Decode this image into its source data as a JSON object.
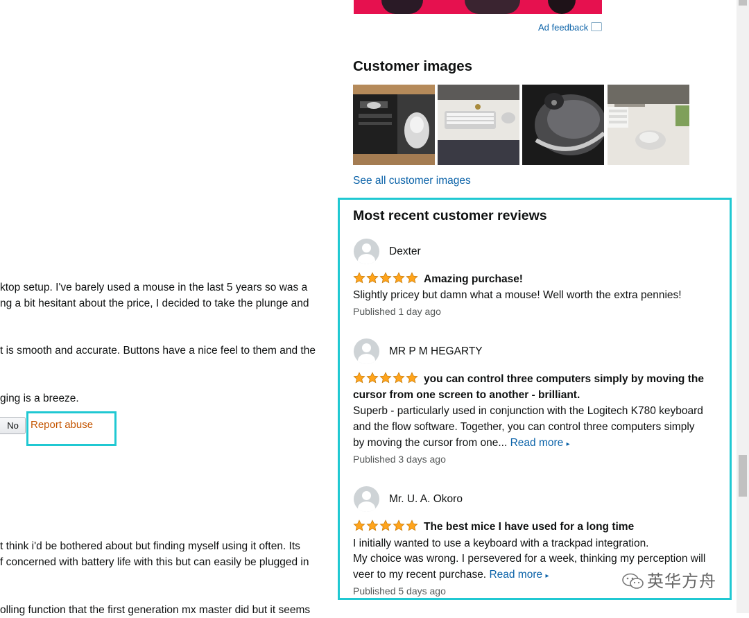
{
  "left_review": {
    "lines": [
      "ktop setup. I've barely used a mouse in the last 5 years so was a",
      "ng a bit hesitant about the price, I decided to take the plunge and",
      "t is smooth and accurate. Buttons have a nice feel to them and the",
      "ging is a breeze."
    ],
    "no_button": "No",
    "report_abuse": "Report abuse"
  },
  "left_review_2": {
    "lines": [
      "t think i'd be bothered about but finding myself using it often. Its",
      "f concerned with battery life with this but can easily be plugged in",
      "olling function that the first generation mx master did but it seems"
    ]
  },
  "ad": {
    "feedback_label": "Ad feedback"
  },
  "customer_images": {
    "heading": "Customer images",
    "see_all": "See all customer images"
  },
  "recent_reviews": {
    "heading": "Most recent customer reviews",
    "reviews": [
      {
        "reviewer": "Dexter",
        "stars": 5,
        "title_lines": [
          "Amazing purchase!"
        ],
        "body_lines": [
          "Slightly pricey but damn what a mouse! Well worth the extra pennies!"
        ],
        "read_more": "",
        "published": "Published 1 day ago"
      },
      {
        "reviewer": "MR P M HEGARTY",
        "stars": 5,
        "title_lines": [
          "you can control three computers simply by moving the",
          "cursor from one screen to another - brilliant."
        ],
        "body_lines": [
          "Superb - particularly used in conjunction with the Logitech K780 keyboard",
          "and the flow software. Together, you can control three computers simply",
          "by moving the cursor from one..."
        ],
        "read_more": "Read more",
        "published": "Published 3 days ago"
      },
      {
        "reviewer": "Mr. U. A. Okoro",
        "stars": 5,
        "title_lines": [
          "The best mice I have used for a long time"
        ],
        "body_lines": [
          "I initially wanted to use a keyboard with a trackpad integration.",
          "My choice was wrong. I persevered for a week, thinking my perception will",
          "veer to my recent purchase."
        ],
        "read_more": "Read more",
        "published": "Published 5 days ago"
      }
    ]
  },
  "watermark": {
    "text": "英华方舟"
  },
  "colors": {
    "highlight": "#20c8d2",
    "star": "#ffa41c",
    "link": "#0a62a8",
    "report": "#c45500"
  }
}
